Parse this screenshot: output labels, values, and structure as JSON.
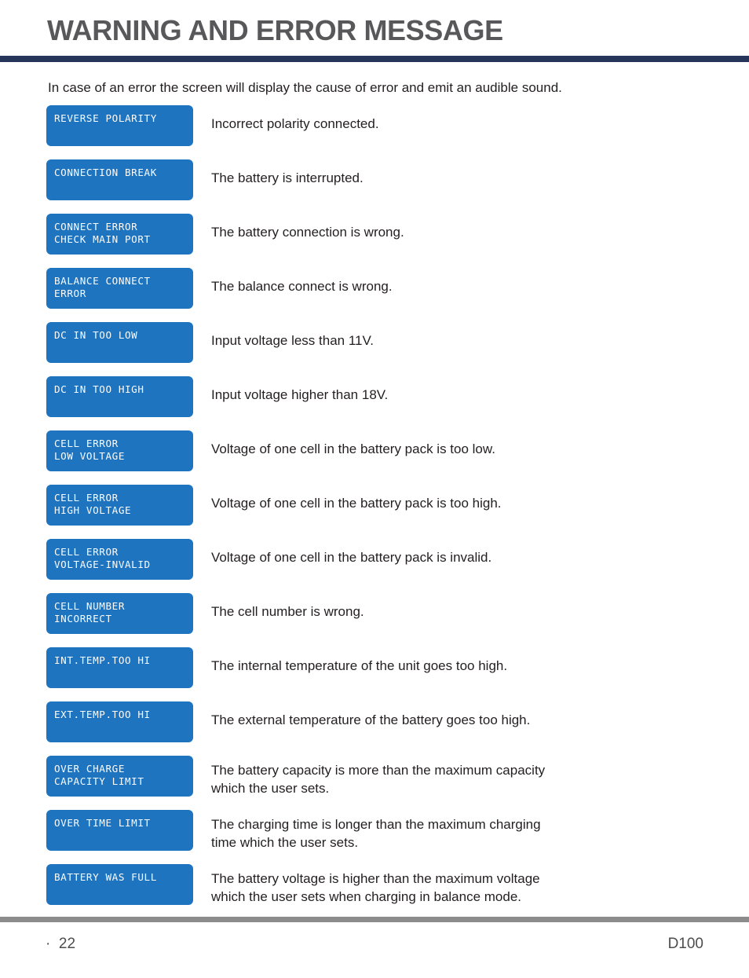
{
  "header": {
    "title": "WARNING AND ERROR MESSAGE",
    "rule_color": "#25365a"
  },
  "intro": {
    "text": "In case of an error the screen will display the cause of error and emit an audible sound."
  },
  "lcd": {
    "background_color": "#1f74c0",
    "text_color": "#fbfcfd"
  },
  "messages": [
    {
      "line1": "REVERSE POLARITY",
      "line2": "",
      "description": "Incorrect polarity connected."
    },
    {
      "line1": "CONNECTION BREAK",
      "line2": "",
      "description": "The battery is interrupted."
    },
    {
      "line1": "CONNECT ERROR",
      "line2": "CHECK MAIN PORT",
      "description": "The battery connection is wrong."
    },
    {
      "line1": "BALANCE CONNECT",
      "line2": "ERROR",
      "description": "The balance connect is wrong."
    },
    {
      "line1": "DC IN TOO LOW",
      "line2": "",
      "description": "Input voltage less than 11V."
    },
    {
      "line1": "DC IN TOO HIGH",
      "line2": "",
      "description": "Input voltage higher than 18V."
    },
    {
      "line1": "CELL ERROR",
      "line2": "LOW VOLTAGE",
      "description": "Voltage of one cell in the battery pack is too low."
    },
    {
      "line1": "CELL ERROR",
      "line2": "HIGH VOLTAGE",
      "description": "Voltage of one cell in the battery pack is too high."
    },
    {
      "line1": "CELL ERROR",
      "line2": "VOLTAGE-INVALID",
      "description": "Voltage of one cell in the battery pack is invalid."
    },
    {
      "line1": "CELL NUMBER",
      "line2": "INCORRECT",
      "description": "The cell number is wrong."
    },
    {
      "line1": "INT.TEMP.TOO HI",
      "line2": "",
      "description": "The internal temperature of the unit goes too high."
    },
    {
      "line1": "EXT.TEMP.TOO HI",
      "line2": "",
      "description": "The external temperature of the battery goes too high."
    },
    {
      "line1": "OVER CHARGE",
      "line2": "CAPACITY LIMIT",
      "description": "The battery capacity is more than the maximum capacity\nwhich the  user sets."
    },
    {
      "line1": "OVER TIME LIMIT",
      "line2": "",
      "description": "The charging time is longer than the maximum charging\ntime which the  user sets."
    },
    {
      "line1": "BATTERY WAS FULL",
      "line2": "",
      "description": "The battery voltage is higher than the maximum voltage\nwhich the  user sets  when charging in balance mode."
    }
  ],
  "footer": {
    "page_number": "·  22",
    "model": "D100",
    "rule_color": "#8c8c8c"
  }
}
